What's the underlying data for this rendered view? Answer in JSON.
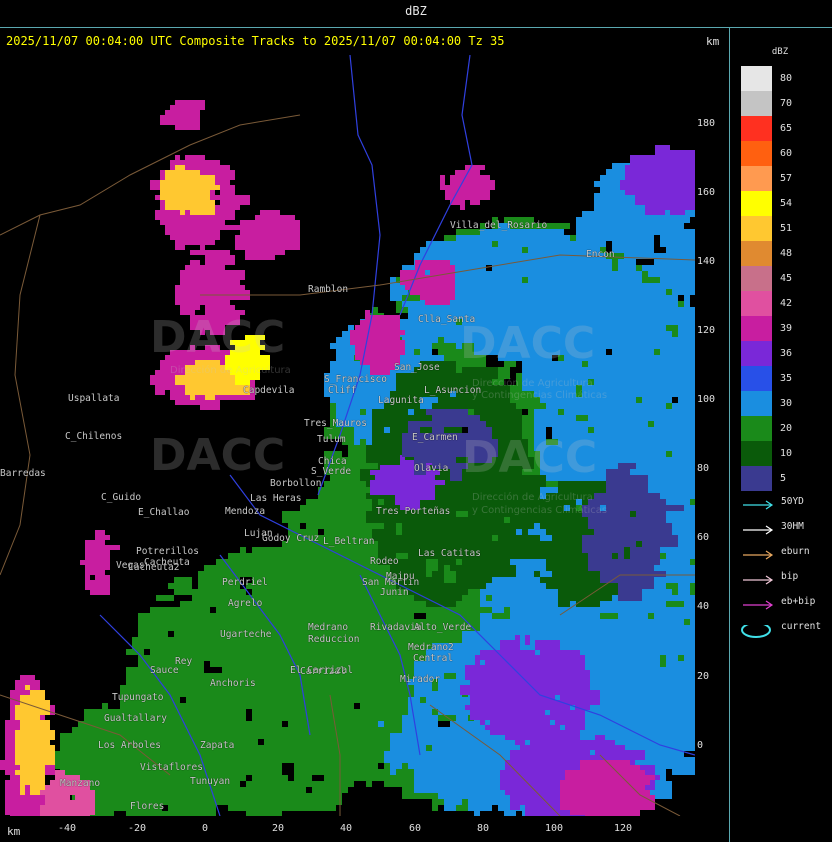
{
  "window": {
    "title": "dBZ"
  },
  "header": {
    "text": "2025/11/07 00:04:00 UTC Composite Tracks to 2025/11/07 00:04:00 Tz 35",
    "unit_top": "km",
    "unit_bottom": "km"
  },
  "y_ticks": [
    "180",
    "160",
    "140",
    "120",
    "100",
    "80",
    "60",
    "40",
    "20",
    "0"
  ],
  "x_ticks": [
    "-40",
    "-20",
    "0",
    "20",
    "40",
    "60",
    "80",
    "100",
    "120"
  ],
  "legend": {
    "title": "dBZ",
    "levels": [
      {
        "label": "80",
        "color": "#e6e6e6"
      },
      {
        "label": "70",
        "color": "#c4c4c4"
      },
      {
        "label": "65",
        "color": "#ff3020"
      },
      {
        "label": "60",
        "color": "#ff6010"
      },
      {
        "label": "57",
        "color": "#ff9a50"
      },
      {
        "label": "54",
        "color": "#ffff00"
      },
      {
        "label": "51",
        "color": "#ffc830"
      },
      {
        "label": "48",
        "color": "#e08a30"
      },
      {
        "label": "45",
        "color": "#c8708a"
      },
      {
        "label": "42",
        "color": "#e050a0"
      },
      {
        "label": "39",
        "color": "#c81ea0"
      },
      {
        "label": "36",
        "color": "#7a28d8"
      },
      {
        "label": "35",
        "color": "#2850e8"
      },
      {
        "label": "30",
        "color": "#1a8ee0"
      },
      {
        "label": "20",
        "color": "#1a8a1a"
      },
      {
        "label": "10",
        "color": "#0a5a0a"
      },
      {
        "label": "5",
        "color": "#3a3a90"
      }
    ],
    "tracks": [
      {
        "label": "50YD",
        "color": "#40e0e8",
        "type": "arrow"
      },
      {
        "label": "30HM",
        "color": "#ffffff",
        "type": "arrow"
      },
      {
        "label": "eburn",
        "color": "#e8a860",
        "type": "arrow"
      },
      {
        "label": "bip",
        "color": "#f0c8d8",
        "type": "arrow"
      },
      {
        "label": "eb+bip",
        "color": "#e040d0",
        "type": "arrow"
      },
      {
        "label": "current",
        "color": "#40e0e8",
        "type": "ellipse"
      }
    ]
  },
  "watermarks": [
    {
      "name": "DACC",
      "sub1": "Dirección de Agricultura",
      "sub2": "y Contingencias Climáticas"
    },
    {
      "name": "DACC",
      "sub1": "Dirección de Agricultura",
      "sub2": "y Contingencias Climáticas"
    },
    {
      "name": "DACC",
      "sub1": "Dirección de Agricultura",
      "sub2": "y Contingencias Climáticas"
    },
    {
      "name": "DACC",
      "sub1": "Dirección de Agricultura",
      "sub2": "y Contingencias Climáticas"
    }
  ],
  "places": [
    "Villa_del_Rosario",
    "Encon",
    "Ramblon",
    "Clla_Santa",
    "Cliff",
    "Uspallata",
    "Tres_Mauros",
    "S_Francisco",
    "San_Jose",
    "L_Asuncion",
    "Lagunita",
    "Tulum",
    "C_Chilenos",
    "E_Carmen",
    "Chica",
    "Barredas",
    "S_Verde",
    "Borbollon",
    "C_Guido",
    "Olavia",
    "E_Challao",
    "Vegas",
    "Potrerillos",
    "Cacheuta",
    "Perdriel",
    "Agrelo",
    "L_Beltran",
    "Maipu",
    "Rodeo",
    "Junin",
    "Rivadavia",
    "Ugarteche",
    "Medrano",
    "Reduccion",
    "Alto_Verde",
    "Tunuyan",
    "Gualtallary",
    "Zapata",
    "Anchoris",
    "Tupungato",
    "Flores",
    "Vistaflores",
    "Central",
    "Sauce",
    "Rey",
    "Carrizal",
    "Mirador",
    "Cacheuta2",
    "Los Arboles",
    "Manzano",
    "Las Heras",
    "Mendoza",
    "Godoy Cruz",
    "Lujan",
    "Capdevila",
    "El Carrizal",
    "Tres Porteñas",
    "Las Catitas",
    "San Martin",
    "Medrano2"
  ]
}
